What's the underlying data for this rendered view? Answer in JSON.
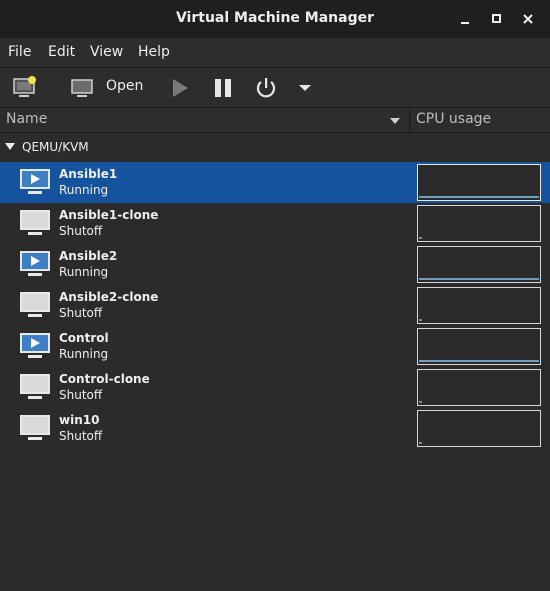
{
  "window": {
    "title": "Virtual Machine Manager"
  },
  "menu": [
    "File",
    "Edit",
    "View",
    "Help"
  ],
  "toolbar": {
    "open_label": "Open"
  },
  "columns": {
    "name": "Name",
    "cpu": "CPU usage"
  },
  "group": {
    "label": "QEMU/KVM"
  },
  "vms": [
    {
      "name": "Ansible1",
      "status": "Running",
      "selected": true
    },
    {
      "name": "Ansible1-clone",
      "status": "Shutoff"
    },
    {
      "name": "Ansible2",
      "status": "Running"
    },
    {
      "name": "Ansible2-clone",
      "status": "Shutoff"
    },
    {
      "name": "Control",
      "status": "Running"
    },
    {
      "name": "Control-clone",
      "status": "Shutoff"
    },
    {
      "name": "win10",
      "status": "Shutoff"
    }
  ],
  "colors": {
    "selected": "#15539e",
    "running_screen": "#3d7fc4",
    "shutoff_screen": "#d9d9d9"
  }
}
